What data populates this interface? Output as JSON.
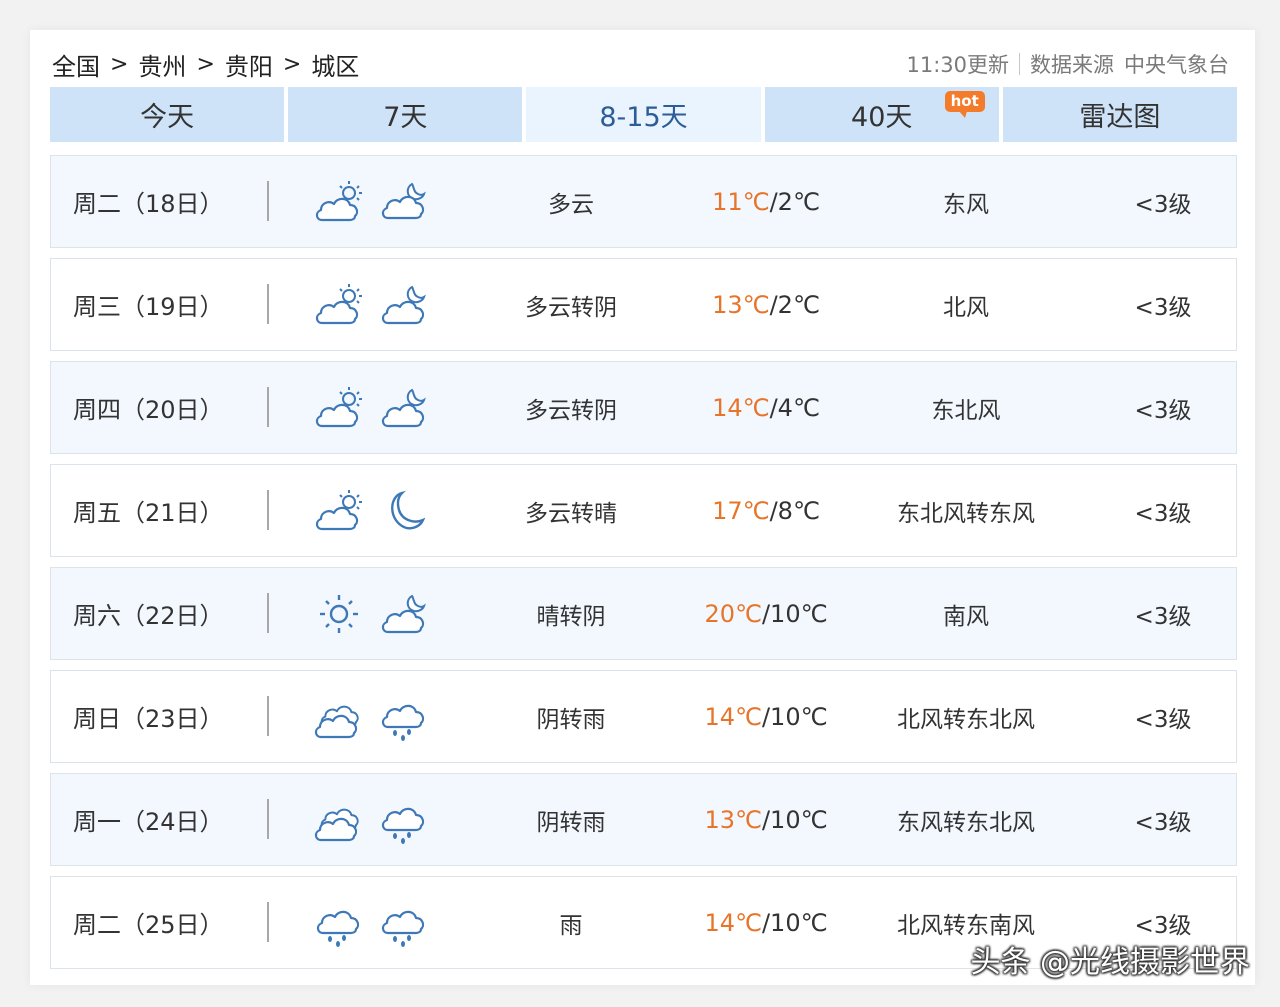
{
  "breadcrumb": {
    "items": [
      "全国",
      "贵州",
      "贵阳",
      "城区"
    ],
    "separator": ">"
  },
  "update": {
    "time_text": "11:30更新",
    "source_label": "数据来源",
    "source": "中央气象台"
  },
  "tabs": [
    {
      "label": "今天",
      "active": false
    },
    {
      "label": "7天",
      "active": false
    },
    {
      "label": "8-15天",
      "active": true
    },
    {
      "label": "40天",
      "active": false,
      "badge": "hot"
    },
    {
      "label": "雷达图",
      "active": false
    }
  ],
  "colors": {
    "accent": "#2c5d96",
    "tab_bg": "#cfe3f8",
    "high_temp": "#e8742a",
    "hot_badge": "#f37b29",
    "icon": "#3e78b7"
  },
  "rows": [
    {
      "date": "周二（18日）",
      "icon_day": "partly-cloudy-day-icon",
      "icon_night": "cloudy-night-icon",
      "condition": "多云",
      "high": "11℃",
      "low": "2℃",
      "wind": "东风",
      "level": "<3级"
    },
    {
      "date": "周三（19日）",
      "icon_day": "partly-cloudy-day-icon",
      "icon_night": "moon-cloud-icon",
      "condition": "多云转阴",
      "high": "13℃",
      "low": "2℃",
      "wind": "北风",
      "level": "<3级"
    },
    {
      "date": "周四（20日）",
      "icon_day": "partly-cloudy-day-icon",
      "icon_night": "moon-cloud-icon",
      "condition": "多云转阴",
      "high": "14℃",
      "low": "4℃",
      "wind": "东北风",
      "level": "<3级"
    },
    {
      "date": "周五（21日）",
      "icon_day": "partly-cloudy-day-icon",
      "icon_night": "moon-icon",
      "condition": "多云转晴",
      "high": "17℃",
      "low": "8℃",
      "wind": "东北风转东风",
      "level": "<3级"
    },
    {
      "date": "周六（22日）",
      "icon_day": "sun-icon",
      "icon_night": "moon-cloud-icon",
      "condition": "晴转阴",
      "high": "20℃",
      "low": "10℃",
      "wind": "南风",
      "level": "<3级"
    },
    {
      "date": "周日（23日）",
      "icon_day": "overcast-icon",
      "icon_night": "rain-icon",
      "condition": "阴转雨",
      "high": "14℃",
      "low": "10℃",
      "wind": "北风转东北风",
      "level": "<3级"
    },
    {
      "date": "周一（24日）",
      "icon_day": "overcast-icon",
      "icon_night": "rain-icon",
      "condition": "阴转雨",
      "high": "13℃",
      "low": "10℃",
      "wind": "东风转东北风",
      "level": "<3级"
    },
    {
      "date": "周二（25日）",
      "icon_day": "rain-icon",
      "icon_night": "rain-icon",
      "condition": "雨",
      "high": "14℃",
      "low": "10℃",
      "wind": "北风转东南风",
      "level": "<3级"
    }
  ],
  "watermark": "头条 @光线摄影世界"
}
